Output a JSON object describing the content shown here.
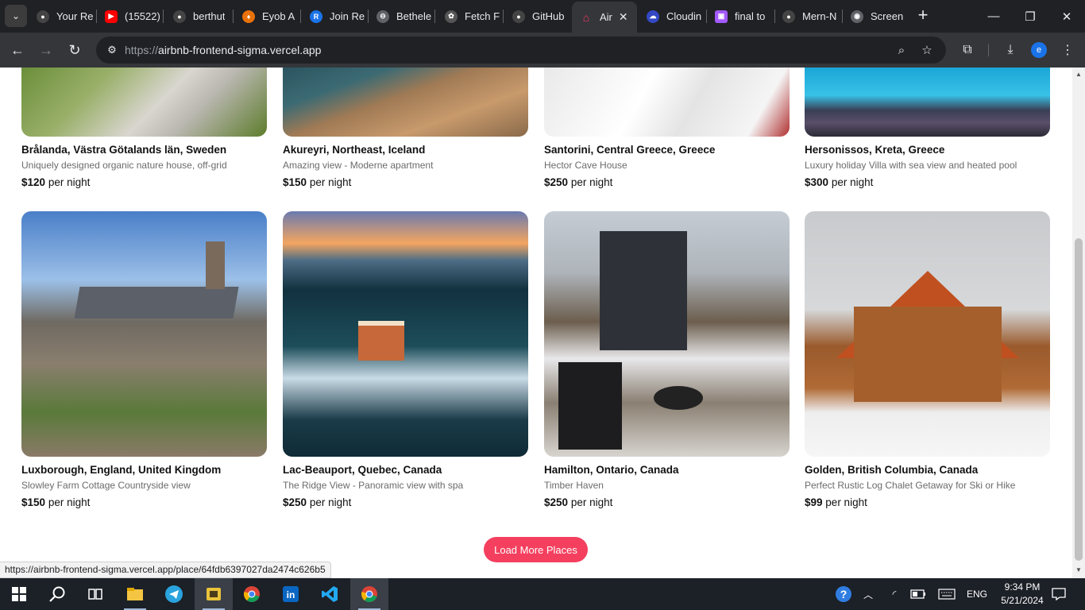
{
  "browser": {
    "tabs": [
      {
        "label": "Your Re",
        "icon": "github-icon",
        "color": "#444"
      },
      {
        "label": "(15522)",
        "icon": "youtube-icon",
        "color": "#ff0000"
      },
      {
        "label": "berthut",
        "icon": "github-icon",
        "color": "#444"
      },
      {
        "label": "Eyob A",
        "icon": "eyob-icon",
        "color": "#e8710a"
      },
      {
        "label": "Join Re",
        "icon": "join-icon",
        "color": "#1a73e8"
      },
      {
        "label": "Bethele",
        "icon": "bethel-icon",
        "color": "#5f6368"
      },
      {
        "label": "Fetch F",
        "icon": "openai-icon",
        "color": "#555"
      },
      {
        "label": "GitHub",
        "icon": "github-icon",
        "color": "#444"
      },
      {
        "label": "Air",
        "icon": "airbnb-icon",
        "color": "#ff385c"
      },
      {
        "label": "Cloudin",
        "icon": "cloudinary-icon",
        "color": "#3448c5"
      },
      {
        "label": "final to",
        "icon": "figma-icon",
        "color": "#a259ff"
      },
      {
        "label": "Mern-N",
        "icon": "github-icon",
        "color": "#444"
      },
      {
        "label": "Screen",
        "icon": "screen-icon",
        "color": "#5f6368"
      }
    ],
    "url_protocol": "https://",
    "url_host": "airbnb-frontend-sigma.vercel.app",
    "profile_initial": "e",
    "status_url": "https://airbnb-frontend-sigma.vercel.app/place/64fdb6397027da2474c626b5"
  },
  "listings_top": [
    {
      "title": "Brålanda, Västra Götalands län, Sweden",
      "desc": "Uniquely designed organic nature house, off-grid",
      "price": "$120",
      "unit": "per night"
    },
    {
      "title": "Akureyri, Northeast, Iceland",
      "desc": "Amazing view - Moderne apartment",
      "price": "$150",
      "unit": "per night"
    },
    {
      "title": "Santorini, Central Greece, Greece",
      "desc": "Hector Cave House",
      "price": "$250",
      "unit": "per night"
    },
    {
      "title": "Hersonissos, Kreta, Greece",
      "desc": "Luxury holiday Villa with sea view and heated pool",
      "price": "$300",
      "unit": "per night"
    }
  ],
  "listings_bottom": [
    {
      "title": "Luxborough, England, United Kingdom",
      "desc": "Slowley Farm Cottage Countryside view",
      "price": "$150",
      "unit": "per night"
    },
    {
      "title": "Lac-Beauport, Quebec, Canada",
      "desc": "The Ridge View - Panoramic view with spa",
      "price": "$250",
      "unit": "per night"
    },
    {
      "title": "Hamilton, Ontario, Canada",
      "desc": "Timber Haven",
      "price": "$250",
      "unit": "per night"
    },
    {
      "title": "Golden, British Columbia, Canada",
      "desc": "Perfect Rustic Log Chalet Getaway for Ski or Hike",
      "price": "$99",
      "unit": "per night"
    }
  ],
  "load_more_label": "Load More Places",
  "taskbar": {
    "lang": "ENG",
    "time": "9:34 PM",
    "date": "5/21/2024"
  },
  "colors": {
    "accent": "#f43f5e",
    "chrome_dark": "#202124",
    "chrome_toolbar": "#35363a"
  }
}
